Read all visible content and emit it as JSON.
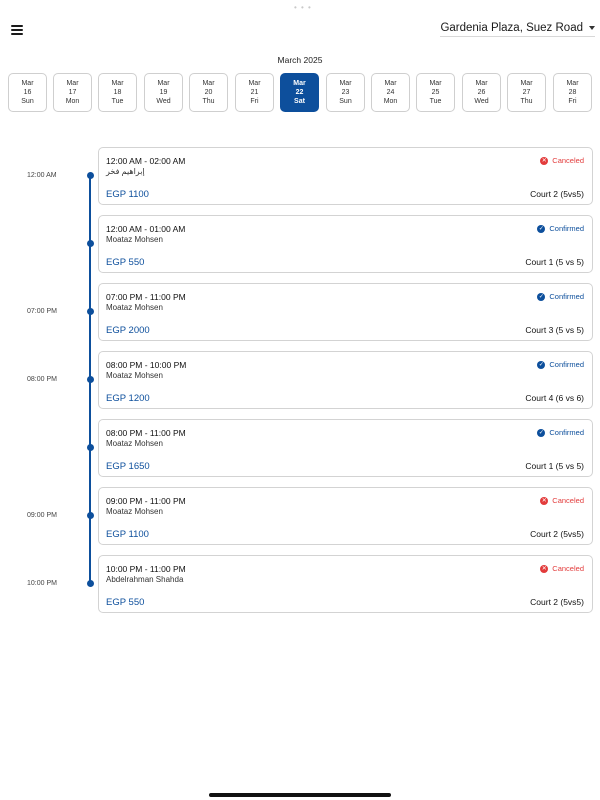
{
  "header": {
    "location": "Gardenia Plaza, Suez Road"
  },
  "calendar": {
    "month": "March 2025",
    "dates": [
      {
        "month": "Mar",
        "day": "16",
        "weekday": "Sun",
        "selected": false
      },
      {
        "month": "Mar",
        "day": "17",
        "weekday": "Mon",
        "selected": false
      },
      {
        "month": "Mar",
        "day": "18",
        "weekday": "Tue",
        "selected": false
      },
      {
        "month": "Mar",
        "day": "19",
        "weekday": "Wed",
        "selected": false
      },
      {
        "month": "Mar",
        "day": "20",
        "weekday": "Thu",
        "selected": false
      },
      {
        "month": "Mar",
        "day": "21",
        "weekday": "Fri",
        "selected": false
      },
      {
        "month": "Mar",
        "day": "22",
        "weekday": "Sat",
        "selected": true
      },
      {
        "month": "Mar",
        "day": "23",
        "weekday": "Sun",
        "selected": false
      },
      {
        "month": "Mar",
        "day": "24",
        "weekday": "Mon",
        "selected": false
      },
      {
        "month": "Mar",
        "day": "25",
        "weekday": "Tue",
        "selected": false
      },
      {
        "month": "Mar",
        "day": "26",
        "weekday": "Wed",
        "selected": false
      },
      {
        "month": "Mar",
        "day": "27",
        "weekday": "Thu",
        "selected": false
      },
      {
        "month": "Mar",
        "day": "28",
        "weekday": "Fri",
        "selected": false
      }
    ]
  },
  "timeline": {
    "labels": [
      "12:00 AM",
      "07:00 PM",
      "08:00 PM",
      "09:00 PM",
      "10:00 PM"
    ]
  },
  "bookings": [
    {
      "time": "12:00 AM - 02:00 AM",
      "name": "إبراهيم فخر",
      "status": "Canceled",
      "price": "EGP 1100",
      "court": "Court 2 (5vs5)"
    },
    {
      "time": "12:00 AM - 01:00 AM",
      "name": "Moataz Mohsen",
      "status": "Confirmed",
      "price": "EGP 550",
      "court": "Court 1 (5 vs 5)"
    },
    {
      "time": "07:00 PM - 11:00 PM",
      "name": "Moataz Mohsen",
      "status": "Confirmed",
      "price": "EGP 2000",
      "court": "Court 3 (5 vs 5)"
    },
    {
      "time": "08:00 PM - 10:00 PM",
      "name": "Moataz Mohsen",
      "status": "Confirmed",
      "price": "EGP 1200",
      "court": "Court 4 (6 vs 6)"
    },
    {
      "time": "08:00 PM - 11:00 PM",
      "name": "Moataz Mohsen",
      "status": "Confirmed",
      "price": "EGP 1650",
      "court": "Court 1 (5 vs 5)"
    },
    {
      "time": "09:00 PM - 11:00 PM",
      "name": "Moataz Mohsen",
      "status": "Canceled",
      "price": "EGP 1100",
      "court": "Court 2 (5vs5)"
    },
    {
      "time": "10:00 PM - 11:00 PM",
      "name": "Abdelrahman  Shahda",
      "status": "Canceled",
      "price": "EGP 550",
      "court": "Court 2 (5vs5)"
    }
  ],
  "colors": {
    "accent": "#0d4f9c",
    "canceled": "#e23b3b"
  }
}
